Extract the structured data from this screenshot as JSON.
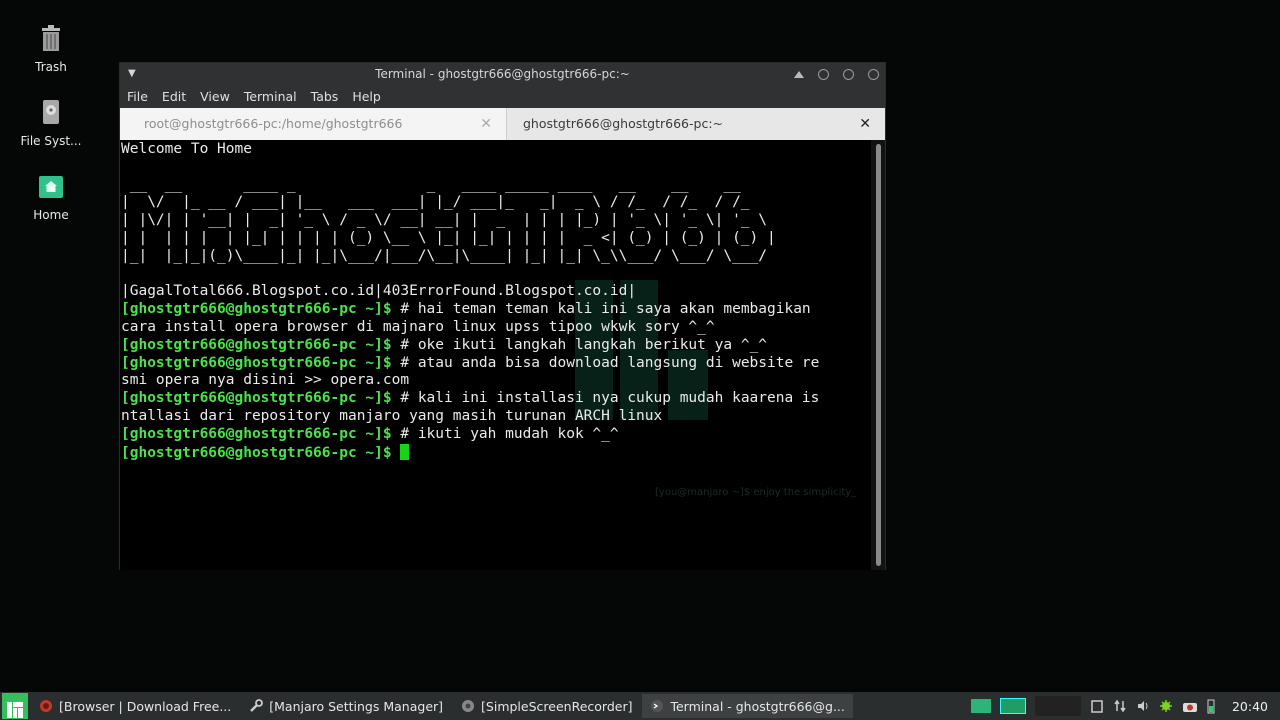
{
  "desktop": {
    "icons": [
      {
        "label": "Trash",
        "icon": "trash-icon"
      },
      {
        "label": "File Syst...",
        "icon": "drive-icon"
      },
      {
        "label": "Home",
        "icon": "home-folder-icon"
      }
    ]
  },
  "window": {
    "title": "Terminal - ghostgtr666@ghostgtr666-pc:~",
    "menu": [
      "File",
      "Edit",
      "View",
      "Terminal",
      "Tabs",
      "Help"
    ],
    "tabs": [
      {
        "label": "root@ghostgtr666-pc:/home/ghostgtr666",
        "close": "✕"
      },
      {
        "label": "ghostgtr666@ghostgtr666-pc:~",
        "close": "✕"
      }
    ]
  },
  "terminal": {
    "welcome": "Welcome To Home",
    "banner": [
      " __  __       ____ _               _   ____ _____ ____   __    __    __  ",
      "|  \\/  |_ __ / ___| |__   ___  ___| |_/ ___|_   _|  _ \\ / /_  / /_  / /_ ",
      "| |\\/| | '__| |  _| '_ \\ / _ \\/ __| __| |  _  | | | |_) | '_ \\| '_ \\| '_ \\",
      "| |  | | |  | |_| | | | | (_) \\__ \\ |_| |_| | | | |  _ <| (_) | (_) | (_) |",
      "|_|  |_|_|(_)\\____|_| |_|\\___/|___/\\__|\\____| |_| |_| \\_\\\\___/ \\___/ \\___/ "
    ],
    "sites": "|GagalTotal666.Blogspot.co.id|403ErrorFound.Blogspot.co.id|",
    "prompt": "[ghostgtr666@ghostgtr666-pc ~]$",
    "lines": [
      {
        "cmd": " # hai teman teman kali ini saya akan membagikan",
        "cont": "cara install opera browser di majnaro linux upss tipoo wkwk sory ^_^"
      },
      {
        "cmd": " # oke ikuti langkah langkah berikut ya ^_^",
        "cont": ""
      },
      {
        "cmd": " # atau anda bisa download langsung di website re",
        "cont": "smi opera nya disini >> opera.com"
      },
      {
        "cmd": " # kali ini installasi nya cukup mudah kaarena is",
        "cont": "ntallasi dari repository manjaro yang masih turunan ARCH linux"
      },
      {
        "cmd": " # ikuti yah mudah kok ^_^",
        "cont": ""
      }
    ],
    "watermark": "[you@manjaro ~]$ enjoy the simplicity_"
  },
  "taskbar": {
    "tasks": [
      {
        "label": "[Browser | Download Free...",
        "icon": "browser-icon"
      },
      {
        "label": "[Manjaro Settings Manager]",
        "icon": "wrench-icon"
      },
      {
        "label": "[SimpleScreenRecorder]",
        "icon": "recorder-icon"
      },
      {
        "label": "Terminal - ghostgtr666@g...",
        "icon": "terminal-icon"
      }
    ],
    "clock": "20:40"
  }
}
